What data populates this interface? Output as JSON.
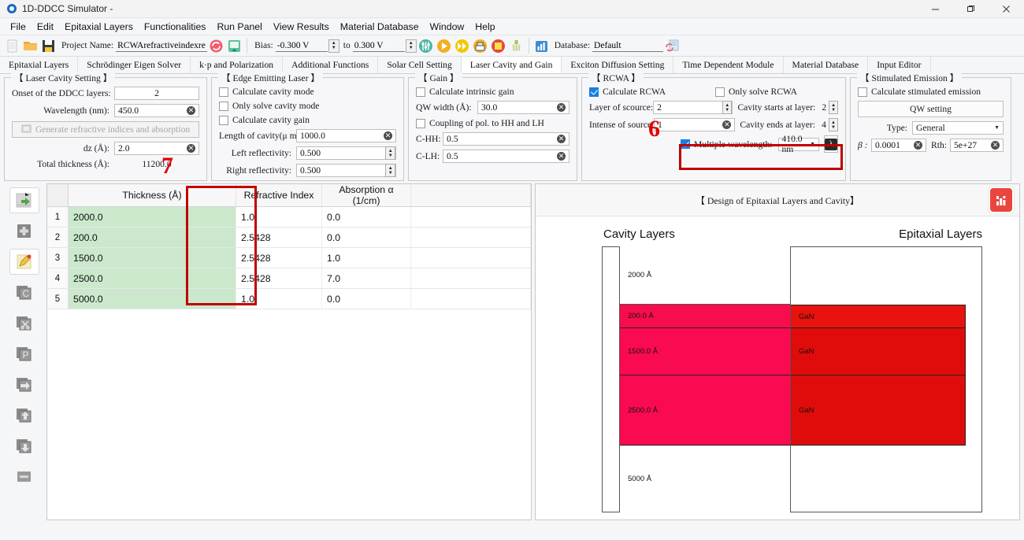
{
  "window": {
    "title": "1D-DDCC Simulator -",
    "minimize": "–",
    "maximize": "❐",
    "close": "✕"
  },
  "menubar": [
    "File",
    "Edit",
    "Epitaxial Layers",
    "Functionalities",
    "Run Panel",
    "View Results",
    "Material Database",
    "Window",
    "Help"
  ],
  "toolbar": {
    "project_label": "Project Name:",
    "project_value": "RCWArefractiveindexreal",
    "bias_label": "Bias:",
    "bias_from": "-0.300 V",
    "bias_to_label": "to",
    "bias_to": "0.300 V",
    "database_label": "Database:",
    "database_value": "Default",
    "icons": [
      "new-file-icon",
      "open-folder-icon",
      "save-disk-icon",
      "refresh-icon",
      "import-icon",
      "mesh-icon",
      "run-icon",
      "run-fast-icon",
      "export-icon",
      "stop-icon",
      "clean-icon",
      "plot-icon",
      "db-refresh-icon"
    ]
  },
  "tabs": [
    {
      "label": "Epitaxial Layers",
      "active": false
    },
    {
      "label": "Schrödinger Eigen Solver",
      "active": false
    },
    {
      "label": "k·p and Polarization",
      "active": false
    },
    {
      "label": "Additional Functions",
      "active": false
    },
    {
      "label": "Solar Cell Setting",
      "active": false
    },
    {
      "label": "Laser Cavity and Gain",
      "active": true
    },
    {
      "label": "Exciton Diffusion Setting",
      "active": false
    },
    {
      "label": "Time Dependent Module",
      "active": false
    },
    {
      "label": "Material Database",
      "active": false
    },
    {
      "label": "Input Editor",
      "active": false
    }
  ],
  "laser_cavity": {
    "title": "【 Laser Cavity Setting 】",
    "onset_label": "Onset of the DDCC layers:",
    "onset_value": "2",
    "wavelength_label": "Wavelength (nm):",
    "wavelength_value": "450.0",
    "generate_button": "Generate refractive indices and absorption",
    "dz_label": "dz (Å):",
    "dz_value": "2.0",
    "total_label": "Total thickness (Å):",
    "total_value": "11200.0"
  },
  "edge_emitting": {
    "title": "【 Edge Emitting Laser 】",
    "calc_cavity_mode": "Calculate cavity mode",
    "only_solve_cavity_mode": "Only solve cavity mode",
    "calc_cavity_gain": "Calculate cavity gain",
    "length_label": "Length of cavity(μ m):",
    "length_value": "1000.0",
    "left_label": "Left reflectivity:",
    "left_value": "0.500",
    "right_label": "Right reflectivity:",
    "right_value": "0.500"
  },
  "gain": {
    "title": "【 Gain 】",
    "calc_intrinsic_gain": "Calculate intrinsic gain",
    "qw_label": "QW width (Å):",
    "qw_value": "30.0",
    "coupling": "Coupling of pol. to HH and LH",
    "chh_label": "C-HH:",
    "chh_value": "0.5",
    "clh_label": "C-LH:",
    "clh_value": "0.5"
  },
  "rcwa": {
    "title": "【 RCWA 】",
    "calculate_rcwa": "Calculate RCWA",
    "only_solve_rcwa": "Only solve RCWA",
    "layer_of_source_label": "Layer of scource:",
    "layer_of_source_value": "2",
    "intense_of_source_label": "Intense of source:",
    "intense_of_source_value": "1",
    "cavity_starts_label": "Cavity starts at layer:",
    "cavity_starts_value": "2",
    "cavity_ends_label": "Cavity ends at layer:",
    "cavity_ends_value": "4",
    "multiple_wavelength": "Multiple wavelength:",
    "wavelength_option": "410.0 nm",
    "lambda_button": "λ"
  },
  "stimulated": {
    "title": "【 Stimulated Emission 】",
    "calc_label": "Calculate stimulated emission",
    "qw_setting_button": "QW setting",
    "type_label": "Type:",
    "type_value": "General",
    "beta_label": "β :",
    "beta_value": "0.0001",
    "rth_label": "Rth:",
    "rth_value": "5e+27"
  },
  "annotations": [
    {
      "name": "annot-7",
      "text": "7"
    },
    {
      "name": "annot-6",
      "text": "6"
    }
  ],
  "icon_sidebar": [
    {
      "name": "insert-back-icon",
      "selected": false
    },
    {
      "name": "add-plus-icon",
      "selected": false
    },
    {
      "name": "edit-pencil-icon",
      "selected": true
    },
    {
      "name": "copy-c-icon",
      "selected": false
    },
    {
      "name": "cut-scissors-icon",
      "selected": false
    },
    {
      "name": "paste-p-icon",
      "selected": false
    },
    {
      "name": "insert-right-icon",
      "selected": false
    },
    {
      "name": "move-up-icon",
      "selected": false
    },
    {
      "name": "move-down-icon",
      "selected": false
    },
    {
      "name": "delete-minus-icon",
      "selected": false
    }
  ],
  "layer_table": {
    "columns": [
      "",
      "Thickness (Å)",
      "Refractive Index",
      "Absorption α (1/cm)"
    ],
    "rows": [
      {
        "index": "1",
        "thickness": "2000.0",
        "refractive_index": "1.0",
        "absorption": "0.0"
      },
      {
        "index": "2",
        "thickness": "200.0",
        "refractive_index": "2.5428",
        "absorption": "0.0"
      },
      {
        "index": "3",
        "thickness": "1500.0",
        "refractive_index": "2.5428",
        "absorption": "1.0"
      },
      {
        "index": "4",
        "thickness": "2500.0",
        "refractive_index": "2.5428",
        "absorption": "7.0"
      },
      {
        "index": "5",
        "thickness": "5000.0",
        "refractive_index": "1.0",
        "absorption": "0.0"
      }
    ]
  },
  "design": {
    "title": "【 Design of Epitaxial Layers and Cavity】",
    "chart_button": "plot-icon",
    "cavity_header": "Cavity Layers",
    "epitaxial_header": "Epitaxial Layers",
    "cavity_layers": [
      {
        "label": "2000 Å",
        "color": "#ffffff",
        "height_pct": 21.8
      },
      {
        "label": "200.0 Å",
        "color": "#f70d4e",
        "height_pct": 8.9
      },
      {
        "label": "1500.0 Å",
        "color": "#fa0a50",
        "height_pct": 17.8
      },
      {
        "label": "2500.0 Å",
        "color": "#fa0a50",
        "height_pct": 26.3
      },
      {
        "label": "5000 Å",
        "color": "#ffffff",
        "height_pct": 25.2
      }
    ],
    "epitaxial_layers": [
      {
        "label": "GaN",
        "color": "#e8120f",
        "height_pct": 8.9
      },
      {
        "label": "GaN",
        "color": "#e00c0c",
        "height_pct": 17.8
      },
      {
        "label": "GaN",
        "color": "#e00c0c",
        "height_pct": 26.3
      }
    ]
  },
  "colors": {
    "accent": "#1a7fe0",
    "annotation_red": "#c00000",
    "thickness_cell": "#cbe8cd",
    "cavity_pink": "#fa0a50",
    "epi_red": "#e00c0c"
  }
}
